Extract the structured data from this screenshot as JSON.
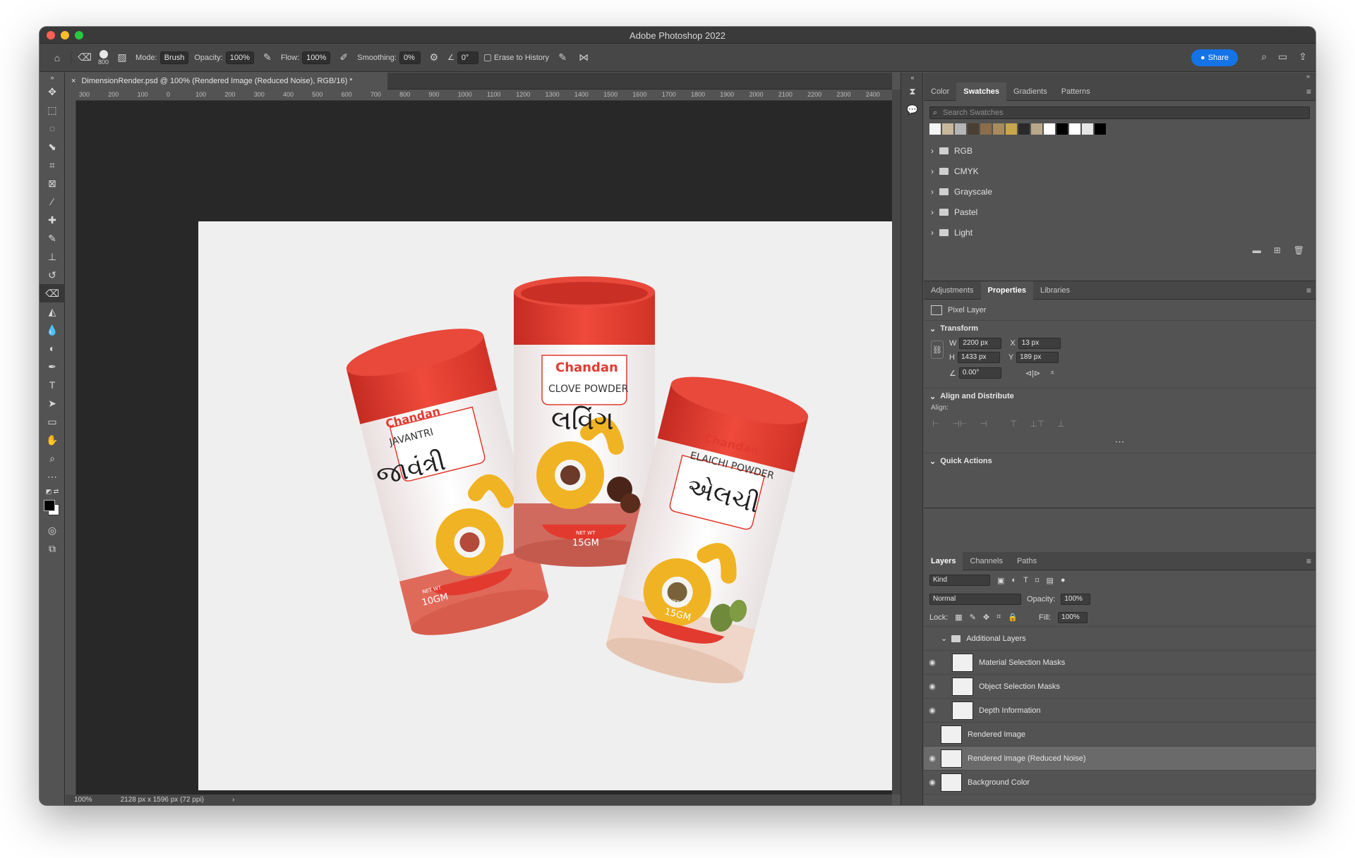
{
  "app": {
    "title": "Adobe Photoshop 2022"
  },
  "options": {
    "brush_size": "800",
    "mode_label": "Mode:",
    "mode_value": "Brush",
    "opacity_label": "Opacity:",
    "opacity_value": "100%",
    "flow_label": "Flow:",
    "flow_value": "100%",
    "smoothing_label": "Smoothing:",
    "smoothing_value": "0%",
    "angle_value": "0°",
    "erase_history_label": "Erase to History",
    "share_label": "Share"
  },
  "document": {
    "tab_title": "DimensionRender.psd @ 100% (Rendered Image (Reduced Noise), RGB/16) *",
    "zoom": "100%",
    "info": "2128 px x 1596 px (72 ppi)",
    "ruler_ticks": [
      "300",
      "200",
      "100",
      "0",
      "100",
      "200",
      "300",
      "400",
      "500",
      "600",
      "700",
      "800",
      "900",
      "1000",
      "1100",
      "1200",
      "1300",
      "1400",
      "1500",
      "1600",
      "1700",
      "1800",
      "1900",
      "2000",
      "2100",
      "2200",
      "2300",
      "2400"
    ]
  },
  "artwork": {
    "brand": "Chandan",
    "products": [
      {
        "english": "JAVANTRI",
        "gujarati": "જાવંત્રી",
        "net_wt_label": "NET WT",
        "net_wt": "10GM"
      },
      {
        "english": "CLOVE POWDER",
        "gujarati": "લવિંગ",
        "net_wt_label": "NET WT",
        "net_wt": "15GM"
      },
      {
        "english": "ELAICHI POWDER",
        "gujarati": "એલચી",
        "net_wt_label": "NET WT",
        "net_wt": "15GM"
      }
    ]
  },
  "swatches_panel": {
    "tabs": [
      "Color",
      "Swatches",
      "Gradients",
      "Patterns"
    ],
    "active_tab": "Swatches",
    "search_placeholder": "Search Swatches",
    "colors": [
      "#f5f5f5",
      "#c9b79c",
      "#b5b5b5",
      "#4a3f35",
      "#8b6d4a",
      "#a88b5e",
      "#c9a54e",
      "#2a2a2a",
      "#b9a88a",
      "#ffffff",
      "#000000",
      "#ffffff",
      "#e6e6e6",
      "#000000"
    ],
    "groups": [
      "RGB",
      "CMYK",
      "Grayscale",
      "Pastel",
      "Light"
    ]
  },
  "properties_panel": {
    "tabs": [
      "Adjustments",
      "Properties",
      "Libraries"
    ],
    "active_tab": "Properties",
    "layer_kind": "Pixel Layer",
    "transform_title": "Transform",
    "w_label": "W",
    "w_value": "2200 px",
    "h_label": "H",
    "h_value": "1433 px",
    "x_label": "X",
    "x_value": "13 px",
    "y_label": "Y",
    "y_value": "189 px",
    "angle_value": "0.00°",
    "align_title": "Align and Distribute",
    "align_label": "Align:",
    "quick_actions_title": "Quick Actions"
  },
  "layers_panel": {
    "tabs": [
      "Layers",
      "Channels",
      "Paths"
    ],
    "active_tab": "Layers",
    "filter_kind": "Kind",
    "blend_mode": "Normal",
    "opacity_label": "Opacity:",
    "opacity_value": "100%",
    "lock_label": "Lock:",
    "fill_label": "Fill:",
    "fill_value": "100%",
    "layers": [
      {
        "name": "Additional Layers",
        "type": "group",
        "visible": false
      },
      {
        "name": "Material Selection Masks",
        "type": "child",
        "visible": true
      },
      {
        "name": "Object Selection Masks",
        "type": "child",
        "visible": true
      },
      {
        "name": "Depth Information",
        "type": "child",
        "visible": true
      },
      {
        "name": "Rendered Image",
        "type": "layer",
        "visible": false
      },
      {
        "name": "Rendered Image (Reduced Noise)",
        "type": "layer",
        "visible": true,
        "selected": true
      },
      {
        "name": "Background Color",
        "type": "layer",
        "visible": true
      }
    ]
  },
  "colors": {
    "accent": "#1473e6",
    "lid_red": "#e23a2f",
    "brand_yellow": "#f0b323"
  }
}
